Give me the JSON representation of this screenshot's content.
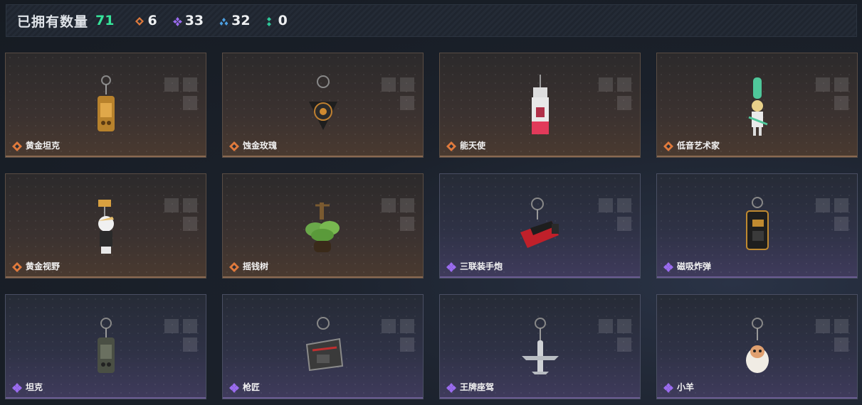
{
  "header": {
    "owned_label": "已拥有数量",
    "owned_count": "71",
    "stats": [
      {
        "icon": "orange-diamond-icon",
        "color": "#e07a3c",
        "value": "6"
      },
      {
        "icon": "purple-diamond-icon",
        "color": "#9b6cf0",
        "value": "33"
      },
      {
        "icon": "blue-diamond-icon",
        "color": "#4d9fe0",
        "value": "32"
      },
      {
        "icon": "green-dots-icon",
        "color": "#2ec99a",
        "value": "0"
      }
    ]
  },
  "items": [
    {
      "name": "黄金坦克",
      "rarity": "gold"
    },
    {
      "name": "蚀金玫瑰",
      "rarity": "gold"
    },
    {
      "name": "能天使",
      "rarity": "gold"
    },
    {
      "name": "低音艺术家",
      "rarity": "gold"
    },
    {
      "name": "黄金视野",
      "rarity": "gold"
    },
    {
      "name": "摇钱树",
      "rarity": "gold"
    },
    {
      "name": "三联装手炮",
      "rarity": "purple"
    },
    {
      "name": "磁吸炸弹",
      "rarity": "purple"
    },
    {
      "name": "坦克",
      "rarity": "purple"
    },
    {
      "name": "枪匠",
      "rarity": "purple"
    },
    {
      "name": "王牌座驾",
      "rarity": "purple"
    },
    {
      "name": "小羊",
      "rarity": "purple"
    }
  ],
  "colors": {
    "gold": "#e07a3c",
    "purple": "#9b6cf0",
    "count_green": "#36e39a"
  }
}
